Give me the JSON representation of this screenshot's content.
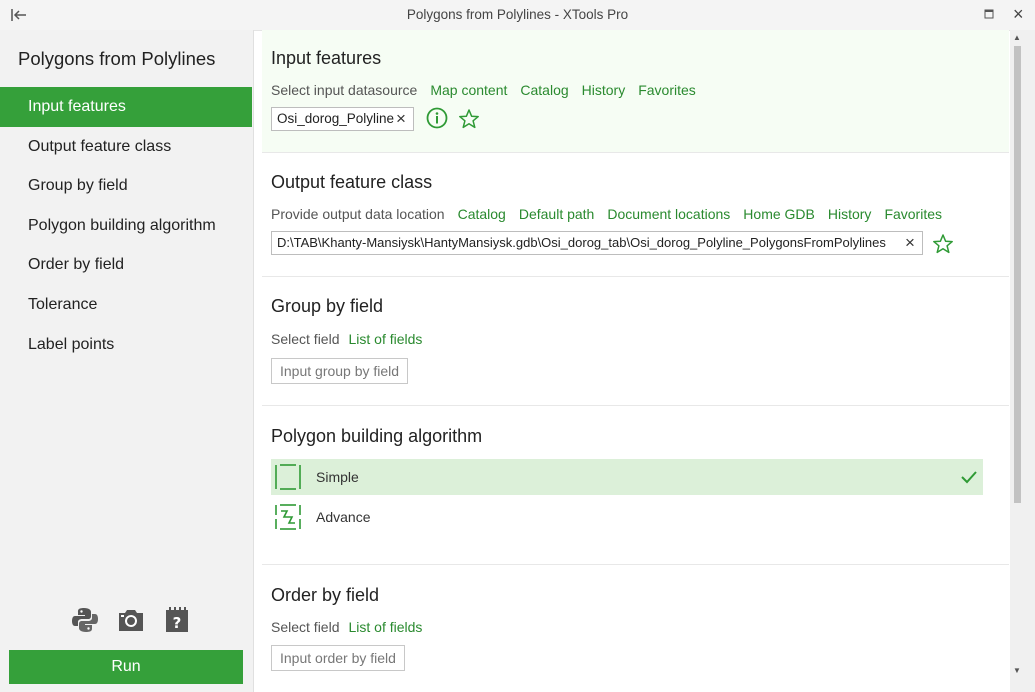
{
  "window": {
    "title": "Polygons from Polylines - XTools Pro"
  },
  "sidebar": {
    "title": "Polygons from Polylines",
    "items": [
      {
        "label": "Input features"
      },
      {
        "label": "Output feature class"
      },
      {
        "label": "Group by field"
      },
      {
        "label": "Polygon building algorithm"
      },
      {
        "label": "Order by field"
      },
      {
        "label": "Tolerance"
      },
      {
        "label": "Label points"
      }
    ],
    "icons": [
      "python-icon",
      "camera-icon",
      "help-notebook-icon"
    ],
    "run_label": "Run"
  },
  "sections": {
    "input_features": {
      "title": "Input features",
      "prompt": "Select input datasource",
      "links": [
        "Map content",
        "Catalog",
        "History",
        "Favorites"
      ],
      "value": "Osi_dorog_Polyline",
      "remove": "×"
    },
    "output_feature_class": {
      "title": "Output feature class",
      "prompt": "Provide output data location",
      "links": [
        "Catalog",
        "Default path",
        "Document locations",
        "Home GDB",
        "History",
        "Favorites"
      ],
      "value": "D:\\TAB\\Khanty-Mansiysk\\HantyMansiysk.gdb\\Osi_dorog_tab\\Osi_dorog_Polyline_PolygonsFromPolylines",
      "remove": "×"
    },
    "group_by_field": {
      "title": "Group by field",
      "prompt": "Select field",
      "link": "List of fields",
      "placeholder": "Input group by field"
    },
    "polygon_algorithm": {
      "title": "Polygon building algorithm",
      "options": [
        {
          "label": "Simple",
          "selected": true
        },
        {
          "label": "Advance",
          "selected": false
        }
      ]
    },
    "order_by_field": {
      "title": "Order by field",
      "prompt": "Select field",
      "link": "List of fields",
      "placeholder": "Input order by field"
    }
  },
  "colors": {
    "accent": "#35a03a",
    "link": "#2a8a2f",
    "selected_bg": "#dcf0d9",
    "section_highlight": "#f6fdf4"
  }
}
